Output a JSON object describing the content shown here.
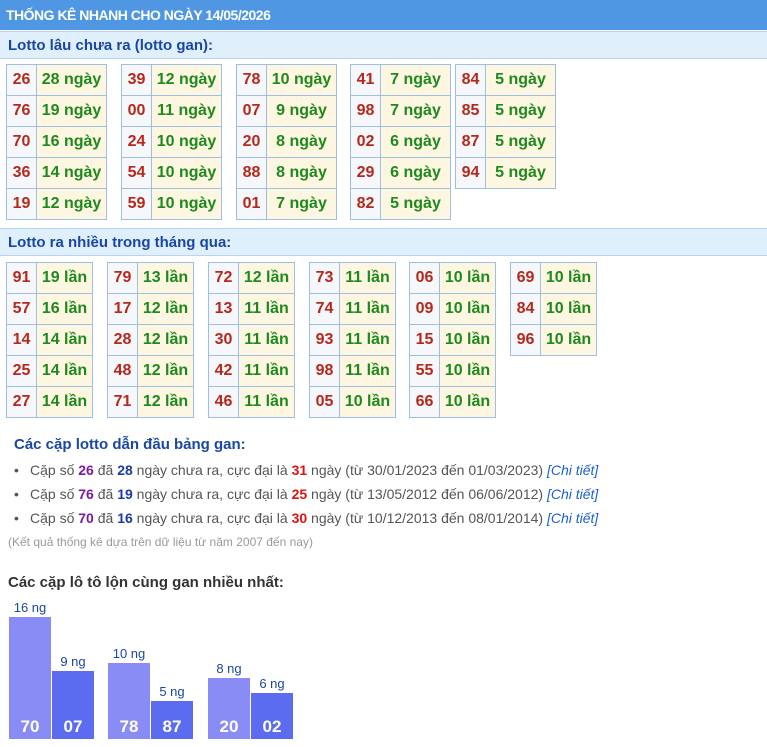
{
  "header": {
    "title": "THỐNG KÊ NHANH CHO NGÀY 14/05/2026"
  },
  "gan": {
    "title": "Lotto lâu chưa ra (lotto gan):",
    "groups": [
      [
        [
          "26",
          "28 ngày"
        ],
        [
          "76",
          "19 ngày"
        ],
        [
          "70",
          "16 ngày"
        ],
        [
          "36",
          "14 ngày"
        ],
        [
          "19",
          "12 ngày"
        ]
      ],
      [
        [
          "39",
          "12 ngày"
        ],
        [
          "00",
          "11 ngày"
        ],
        [
          "24",
          "10 ngày"
        ],
        [
          "54",
          "10 ngày"
        ],
        [
          "59",
          "10 ngày"
        ]
      ],
      [
        [
          "78",
          "10 ngày"
        ],
        [
          "07",
          "9 ngày"
        ],
        [
          "20",
          "8 ngày"
        ],
        [
          "88",
          "8 ngày"
        ],
        [
          "01",
          "7 ngày"
        ]
      ],
      [
        [
          "41",
          "7 ngày"
        ],
        [
          "98",
          "7 ngày"
        ],
        [
          "02",
          "6 ngày"
        ],
        [
          "29",
          "6 ngày"
        ],
        [
          "82",
          "5 ngày"
        ]
      ],
      [
        [
          "84",
          "5 ngày"
        ],
        [
          "85",
          "5 ngày"
        ],
        [
          "87",
          "5 ngày"
        ],
        [
          "94",
          "5 ngày"
        ]
      ]
    ]
  },
  "nhieu": {
    "title": "Lotto ra nhiều trong tháng qua:",
    "groups": [
      [
        [
          "91",
          "19 lần"
        ],
        [
          "57",
          "16 lần"
        ],
        [
          "14",
          "14 lần"
        ],
        [
          "25",
          "14 lần"
        ],
        [
          "27",
          "14 lần"
        ]
      ],
      [
        [
          "79",
          "13 lần"
        ],
        [
          "17",
          "12 lần"
        ],
        [
          "28",
          "12 lần"
        ],
        [
          "48",
          "12 lần"
        ],
        [
          "71",
          "12 lần"
        ]
      ],
      [
        [
          "72",
          "12 lần"
        ],
        [
          "13",
          "11 lần"
        ],
        [
          "30",
          "11 lần"
        ],
        [
          "42",
          "11 lần"
        ],
        [
          "46",
          "11 lần"
        ]
      ],
      [
        [
          "73",
          "11 lần"
        ],
        [
          "74",
          "11 lần"
        ],
        [
          "93",
          "11 lần"
        ],
        [
          "98",
          "11 lần"
        ],
        [
          "05",
          "10 lần"
        ]
      ],
      [
        [
          "06",
          "10 lần"
        ],
        [
          "09",
          "10 lần"
        ],
        [
          "15",
          "10 lần"
        ],
        [
          "55",
          "10 lần"
        ],
        [
          "66",
          "10 lần"
        ]
      ],
      [
        [
          "69",
          "10 lần"
        ],
        [
          "84",
          "10 lần"
        ],
        [
          "96",
          "10 lần"
        ]
      ]
    ]
  },
  "info": {
    "title": "Các cặp lotto dẫn đầu bảng gan:",
    "rows": [
      {
        "p1": "Cặp số ",
        "num": "26",
        "p2": " đã ",
        "days": "28",
        "p3": " ngày chưa ra, cực đại là ",
        "max": "31",
        "p4": " ngày (từ 30/01/2023 đến 01/03/2023) ",
        "link": "[Chi tiết]"
      },
      {
        "p1": "Cặp số ",
        "num": "76",
        "p2": " đã ",
        "days": "19",
        "p3": " ngày chưa ra, cực đại là ",
        "max": "25",
        "p4": " ngày (từ 13/05/2012 đến 06/06/2012) ",
        "link": "[Chi tiết]"
      },
      {
        "p1": "Cặp số ",
        "num": "70",
        "p2": " đã ",
        "days": "16",
        "p3": " ngày chưa ra, cực đại là ",
        "max": "30",
        "p4": " ngày (từ 10/12/2013 đến 08/01/2014) ",
        "link": "[Chi tiết]"
      }
    ],
    "note": "(Kết quả thống kê dựa trên dữ liệu từ năm 2007 đến nay)"
  },
  "pairs": {
    "title": "Các cặp lô tô lộn cùng gan nhiều nhất:",
    "colors": {
      "primary": "#8a8cf5",
      "secondary": "#5b6cf0"
    },
    "items": [
      {
        "num": "70",
        "days": 16,
        "label": "16 ng",
        "kind": "primary"
      },
      {
        "num": "07",
        "days": 9,
        "label": "9 ng",
        "kind": "secondary"
      },
      {
        "num": "78",
        "days": 10,
        "label": "10 ng",
        "kind": "primary"
      },
      {
        "num": "87",
        "days": 5,
        "label": "5 ng",
        "kind": "secondary"
      },
      {
        "num": "20",
        "days": 8,
        "label": "8 ng",
        "kind": "primary"
      },
      {
        "num": "02",
        "days": 6,
        "label": "6 ng",
        "kind": "secondary"
      }
    ]
  }
}
